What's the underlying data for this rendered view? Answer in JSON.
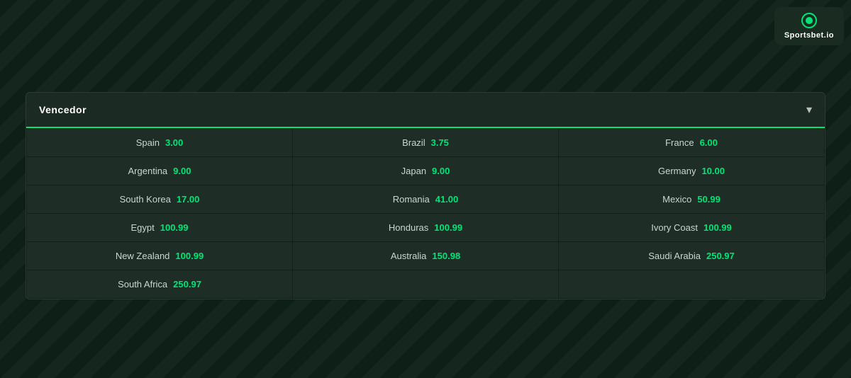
{
  "logo": {
    "text": "Sportsbet.io"
  },
  "panel": {
    "title": "Vencedor",
    "chevron": "▾",
    "rows": [
      [
        {
          "country": "Spain",
          "odds": "3.00"
        },
        {
          "country": "Brazil",
          "odds": "3.75"
        },
        {
          "country": "France",
          "odds": "6.00"
        }
      ],
      [
        {
          "country": "Argentina",
          "odds": "9.00"
        },
        {
          "country": "Japan",
          "odds": "9.00"
        },
        {
          "country": "Germany",
          "odds": "10.00"
        }
      ],
      [
        {
          "country": "South Korea",
          "odds": "17.00"
        },
        {
          "country": "Romania",
          "odds": "41.00"
        },
        {
          "country": "Mexico",
          "odds": "50.99"
        }
      ],
      [
        {
          "country": "Egypt",
          "odds": "100.99"
        },
        {
          "country": "Honduras",
          "odds": "100.99"
        },
        {
          "country": "Ivory Coast",
          "odds": "100.99"
        }
      ],
      [
        {
          "country": "New Zealand",
          "odds": "100.99"
        },
        {
          "country": "Australia",
          "odds": "150.98"
        },
        {
          "country": "Saudi Arabia",
          "odds": "250.97"
        }
      ],
      [
        {
          "country": "South Africa",
          "odds": "250.97"
        },
        {
          "country": "",
          "odds": ""
        },
        {
          "country": "",
          "odds": ""
        }
      ]
    ]
  }
}
